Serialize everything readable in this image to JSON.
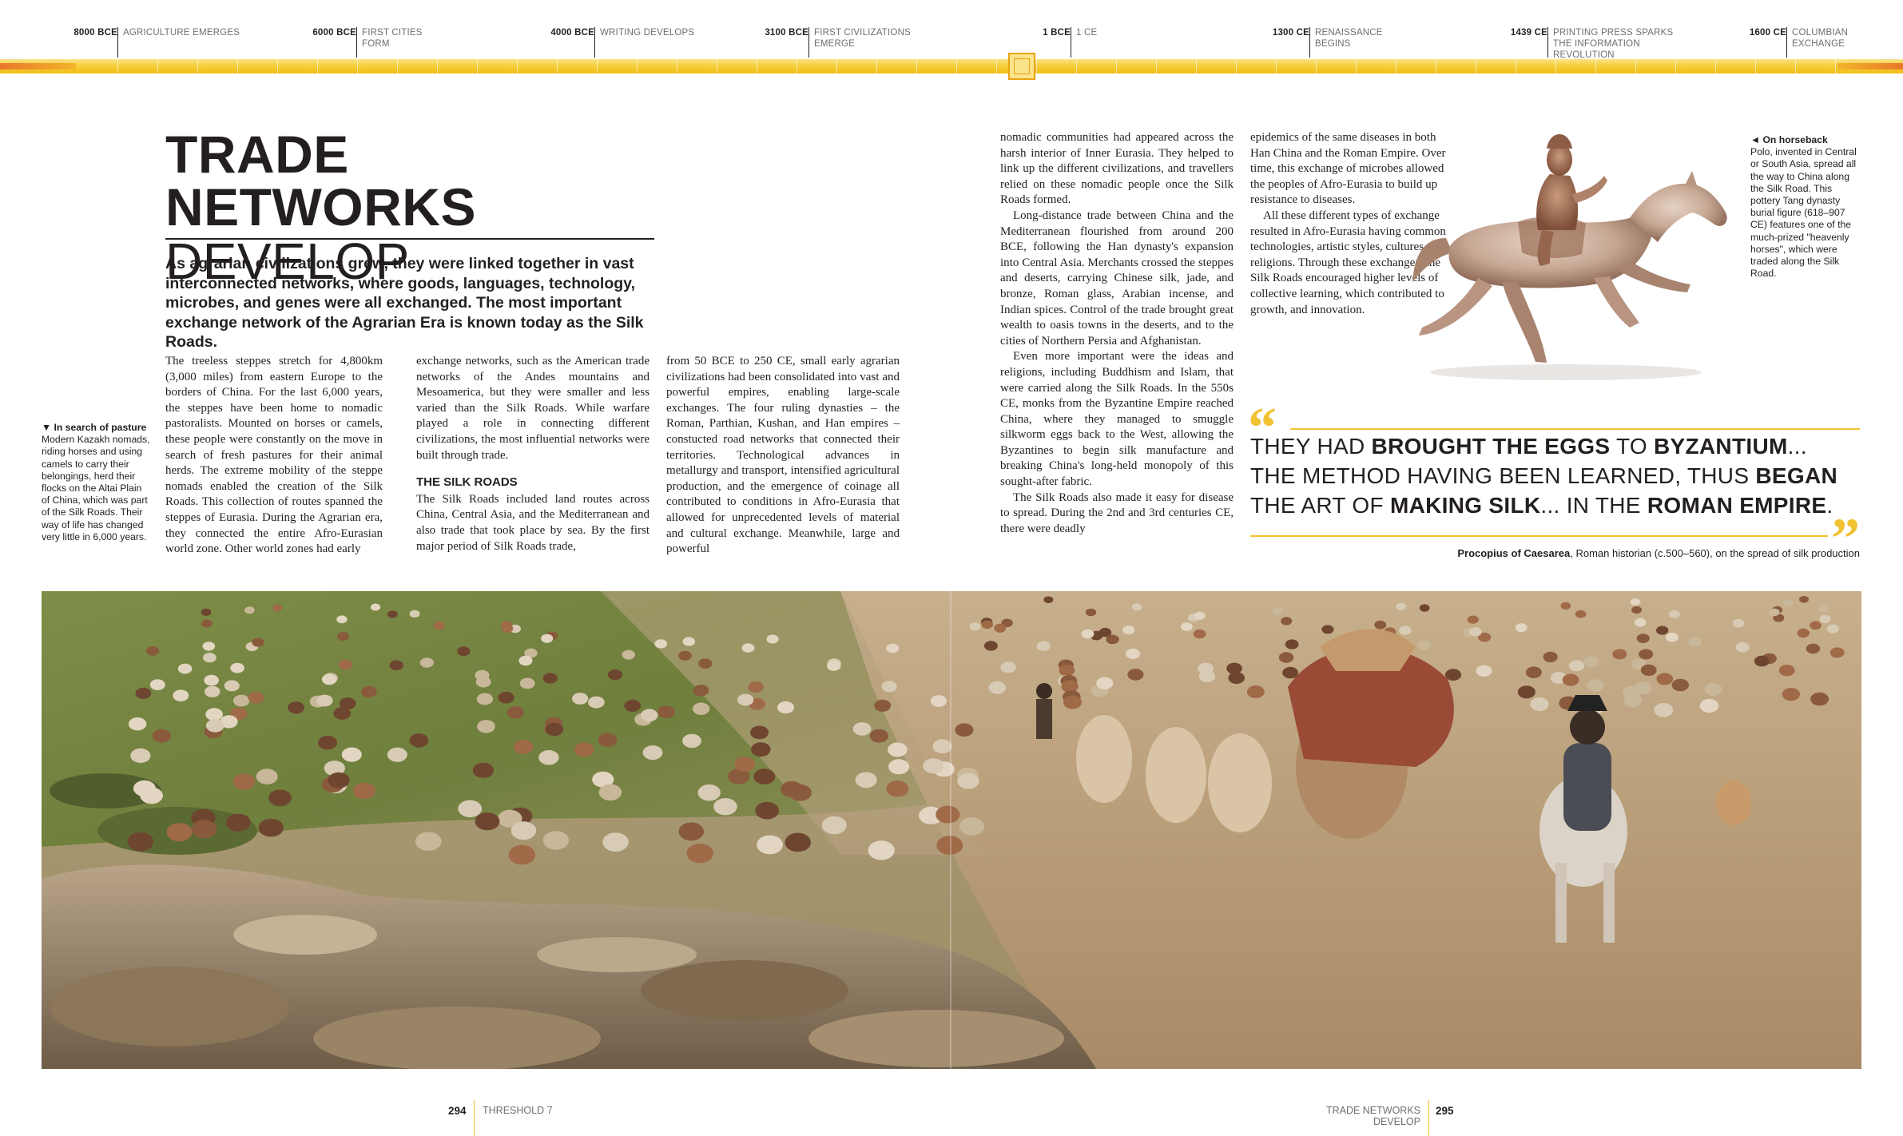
{
  "timeline": {
    "entries": [
      {
        "date": "8000 BCE",
        "label": "AGRICULTURE EMERGES"
      },
      {
        "date": "6000 BCE",
        "label": "FIRST CITIES FORM"
      },
      {
        "date": "4000 BCE",
        "label": "WRITING DEVELOPS"
      },
      {
        "date": "3100 BCE",
        "label": "FIRST CIVILIZATIONS EMERGE"
      },
      {
        "date": "1 BCE",
        "label": "1 CE"
      },
      {
        "date": "1300 CE",
        "label": "RENAISSANCE BEGINS"
      },
      {
        "date": "1439 CE",
        "label": "PRINTING PRESS SPARKS THE INFORMATION REVOLUTION"
      },
      {
        "date": "1600 CE",
        "label": "COLUMBIAN EXCHANGE"
      }
    ]
  },
  "article": {
    "title_line1": "TRADE NETWORKS",
    "title_line2": "DEVELOP",
    "intro": "As agrarian civilizations grew, they were linked together in vast interconnected networks, where goods, languages, technology, microbes, and genes were all exchanged. The most important exchange network of the Agrarian Era is known today as the Silk Roads.",
    "col1": "The treeless steppes stretch for 4,800km (3,000 miles) from eastern Europe to the borders of China. For the last 6,000 years, the steppes have been home to nomadic pastoralists. Mounted on horses or camels, these people were constantly on the move in search of fresh pastures for their animal herds. The extreme mobility of the steppe nomads enabled the creation of the Silk Roads. This collection of routes spanned the steppes of Eurasia. During the Agrarian era, they connected the entire Afro-Eurasian world zone. Other world zones had early",
    "col2a": "exchange networks, such as the American trade networks of the Andes mountains and Mesoamerica, but they were smaller and less varied than the Silk Roads. While warfare played a role in connecting different civilizations, the most influential networks were built through trade.",
    "subhead": "THE SILK ROADS",
    "col2b": "The Silk Roads included land routes across China, Central Asia, and the Mediterranean and also trade that took place by sea. By the first major period of Silk Roads trade,",
    "col3": "from 50 BCE to 250 CE, small early agrarian civilizations had been consolidated into vast and powerful empires, enabling large-scale exchanges. The four ruling dynasties – the Roman, Parthian, Kushan, and Han empires – constucted road networks that connected their territories. Technological advances in metallurgy and transport, intensified agricultural production, and the emergence of coinage all contributed to conditions in Afro-Eurasia that allowed for unprecedented levels of material and cultural exchange. Meanwhile, large and powerful",
    "col4a": "nomadic communities had appeared across the harsh interior of Inner Eurasia. They helped to link up the different civilizations, and travellers relied on these nomadic people once the Silk Roads formed.",
    "col4b": "Long-distance trade between China and the Mediterranean flourished from around 200 BCE, following the Han dynasty's expansion into Central Asia. Merchants crossed the steppes and deserts, carrying Chinese silk, jade, and bronze, Roman glass, Arabian incense, and Indian spices. Control of the trade brought great wealth to oasis towns in the deserts, and to the cities of Northern Persia and Afghanistan.",
    "col4c": "Even more important were the ideas and religions, including Buddhism and Islam, that were carried along the Silk Roads. In the 550s CE, monks from the Byzantine Empire reached China, where they managed to smuggle silkworm eggs back to the West, allowing the Byzantines to begin silk manufacture and breaking China's long-held monopoly of this sought-after fabric.",
    "col4d": "The Silk Roads also made it easy for disease to spread. During the 2nd and 3rd centuries CE, there were deadly",
    "col5a": "epidemics of the same diseases in both Han China and the Roman Empire. Over time, this exchange of microbes allowed the peoples of Afro-Eurasia to build up resistance to diseases.",
    "col5b": "All these different types of exchange resulted in Afro-Eurasia having common technologies, artistic styles, cultures, and religions. Through these exchanges, the Silk Roads encouraged higher levels of collective learning, which contributed to growth, and innovation."
  },
  "captions": {
    "pasture_title": "▼ In search of pasture",
    "pasture_text": "Modern Kazakh nomads, riding horses and using camels to carry their belongings, herd their flocks on the Altai Plain of China, which was part of the Silk Roads. Their way of life has changed very little in 6,000 years.",
    "horse_title": "◄ On horseback",
    "horse_text": "Polo, invented in Central or South Asia, spread all the way to China along the Silk Road. This pottery Tang dynasty burial figure (618–907 CE) features one of the much-prized \"heavenly horses\", which were traded along the Silk Road."
  },
  "quote": {
    "p1": "THEY HAD ",
    "b1": "BROUGHT THE EGGS",
    "p2": " TO ",
    "b2": "BYZANTIUM",
    "p3": "... THE METHOD HAVING BEEN LEARNED, THUS ",
    "b3": "BEGAN",
    "p4": " THE ART OF ",
    "b4": "MAKING SILK",
    "p5": "... IN THE ",
    "b5": "ROMAN EMPIRE",
    "p6": ".",
    "open_mark": "“",
    "close_mark": "”",
    "attr_name": "Procopius of Caesarea",
    "attr_rest": ", Roman historian (c.500–560), on the spread of silk production"
  },
  "footer": {
    "left_page": "294",
    "left_section": "THRESHOLD 7",
    "right_section": "TRADE NETWORKS DEVELOP",
    "right_page": "295"
  },
  "colors": {
    "accent": "#f1c232",
    "timeline_orange": "#e8782a",
    "text": "#231f20"
  }
}
